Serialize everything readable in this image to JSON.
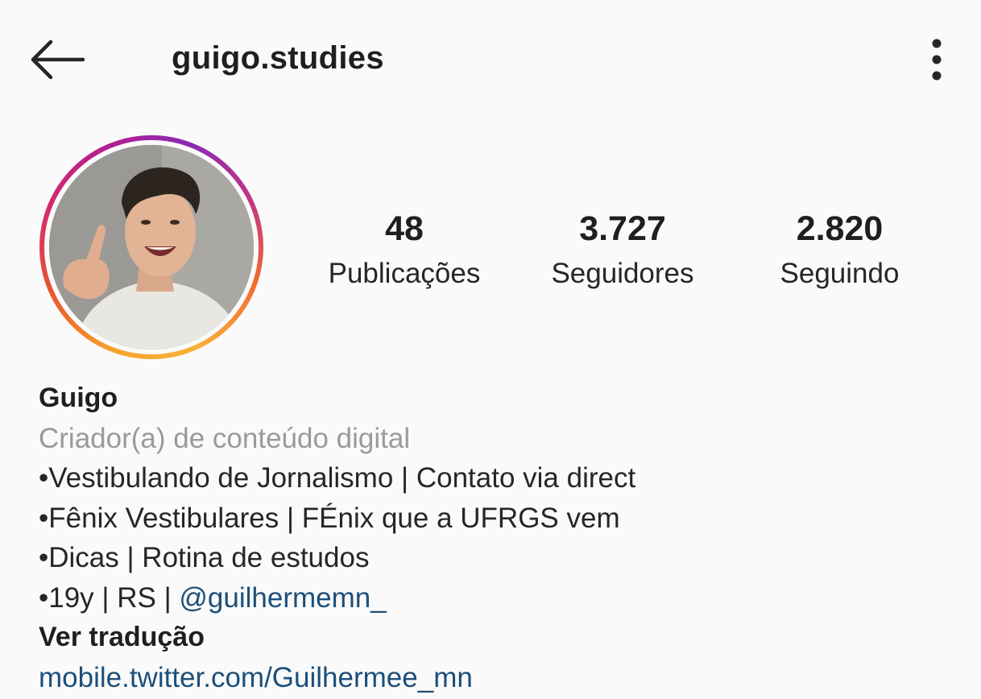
{
  "header": {
    "username": "guigo.studies",
    "back_icon": "arrow-left-icon",
    "menu_icon": "more-vertical-icon"
  },
  "profile": {
    "avatar_ring_colors": [
      "#f7a32c",
      "#e8562f",
      "#d52b6c",
      "#b51f8f",
      "#8a2bb3"
    ],
    "stats": [
      {
        "value": "48",
        "label": "Publicações"
      },
      {
        "value": "3.727",
        "label": "Seguidores"
      },
      {
        "value": "2.820",
        "label": "Seguindo"
      }
    ]
  },
  "bio": {
    "name": "Guigo",
    "category": "Criador(a) de conteúdo digital",
    "lines": [
      "•Vestibulando de Jornalismo | Contato via direct",
      "•Fênix Vestibulares | FÉnix que a UFRGS vem",
      "•Dicas | Rotina de estudos"
    ],
    "last_line_prefix": "•19y | RS | ",
    "mention": "@guilhermemn_",
    "translate_label": "Ver tradução",
    "website": "mobile.twitter.com/Guilhermee_mn"
  },
  "colors": {
    "link": "#1c4f7a",
    "category_text": "#9a9a9a",
    "background": "#fafafa"
  }
}
